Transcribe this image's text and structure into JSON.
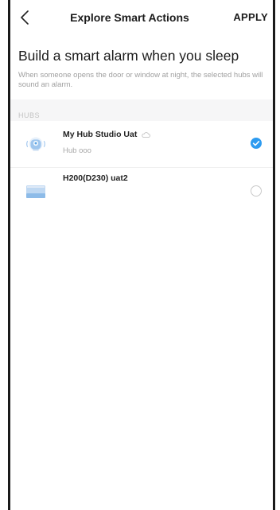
{
  "nav": {
    "title": "Explore Smart Actions",
    "apply_label": "APPLY"
  },
  "main": {
    "heading": "Build a smart alarm when you sleep",
    "description": "When someone opens the door or window at night, the selected hubs will sound an alarm."
  },
  "hubs_section": {
    "label": "HUBS",
    "items": [
      {
        "name": "My Hub Studio Uat",
        "subtitle": "Hub ooo",
        "selected": true,
        "icon": "hub-icon",
        "status_icon": "cloud-icon"
      },
      {
        "name": "H200(D230) uat2",
        "subtitle": "",
        "selected": false,
        "icon": "hub-h200-icon"
      }
    ]
  },
  "colors": {
    "accent": "#2d9bf0",
    "text": "#1c1c1c",
    "secondary_text": "#a0a0a0"
  }
}
